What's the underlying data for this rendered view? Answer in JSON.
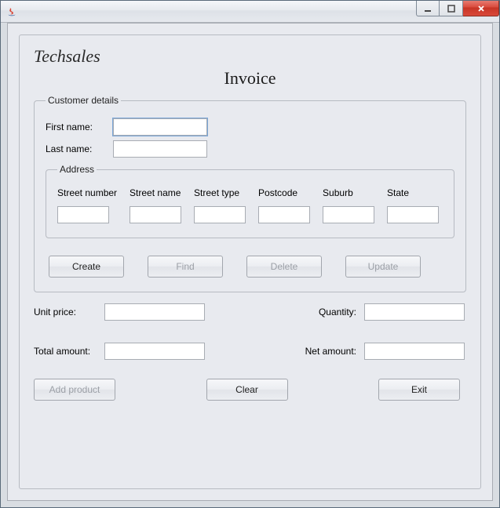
{
  "brand": "Techsales",
  "page_title": "Invoice",
  "customer": {
    "legend": "Customer details",
    "first_name_label": "First name:",
    "first_name_value": "",
    "last_name_label": "Last name:",
    "last_name_value": "",
    "address": {
      "legend": "Address",
      "street_number_label": "Street number",
      "street_number_value": "",
      "street_name_label": "Street name",
      "street_name_value": "",
      "street_type_label": "Street type",
      "street_type_value": "",
      "postcode_label": "Postcode",
      "postcode_value": "",
      "suburb_label": "Suburb",
      "suburb_value": "",
      "state_label": "State",
      "state_value": ""
    },
    "buttons": {
      "create": "Create",
      "find": "Find",
      "delete": "Delete",
      "update": "Update"
    }
  },
  "amounts": {
    "unit_price_label": "Unit price:",
    "unit_price_value": "",
    "quantity_label": "Quantity:",
    "quantity_value": "",
    "total_amount_label": "Total amount:",
    "total_amount_value": "",
    "net_amount_label": "Net amount:",
    "net_amount_value": ""
  },
  "bottom_buttons": {
    "add_product": "Add product",
    "clear": "Clear",
    "exit": "Exit"
  }
}
